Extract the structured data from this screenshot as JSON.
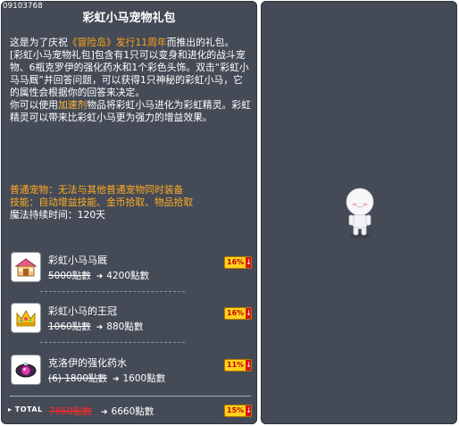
{
  "item_id": "09103768",
  "title": "彩虹小马宠物礼包",
  "description": {
    "p1_a": "这是为了庆祝",
    "p1_b": "《冒险岛》发行11周年",
    "p1_c": "而推出的礼包。",
    "p2": "[彩虹小马宠物礼包]包含有1只可以变身和进化的战斗宠物、6瓶克罗伊的强化药水和1个彩色头饰。双击“彩虹小马马厩”并回答问题，可以获得1只神秘的彩虹小马，它的属性会根据你的回答来决定。",
    "p3_a": "你可以使用",
    "p3_b": "加速剂",
    "p3_c": "物品将彩虹小马进化为彩虹精灵。彩虹精灵可以带来比彩虹小马更为强力的增益效果。"
  },
  "properties": {
    "pet_type": "普通宠物：无法与其他普通宠物同时装备",
    "skills": "技能：自动增益技能、金币拾取、物品拾取",
    "duration": "魔法持续时间：120天"
  },
  "items": [
    {
      "name": "彩虹小马马厩",
      "old_price": "5000點數",
      "new_price": "4200點數",
      "discount": "16%",
      "icon": "stable-icon"
    },
    {
      "name": "彩虹小马的王冠",
      "old_price": "1060點數",
      "new_price": "880點數",
      "discount": "16%",
      "icon": "crown-icon"
    },
    {
      "name": "克洛伊的强化药水",
      "old_price": "(6) 1800點數",
      "new_price": "1600點數",
      "discount": "11%",
      "icon": "potion-icon"
    }
  ],
  "total": {
    "label": "▸ TOTAL",
    "old_price": "7860點數",
    "new_price": "6660點數",
    "discount": "15%"
  },
  "arrow_symbol": "➜",
  "down_symbol": "↓",
  "colors": {
    "panel": "#454b56",
    "highlight": "#ffa31a",
    "badge": "#ffd21c",
    "badge_down": "#d81414"
  }
}
